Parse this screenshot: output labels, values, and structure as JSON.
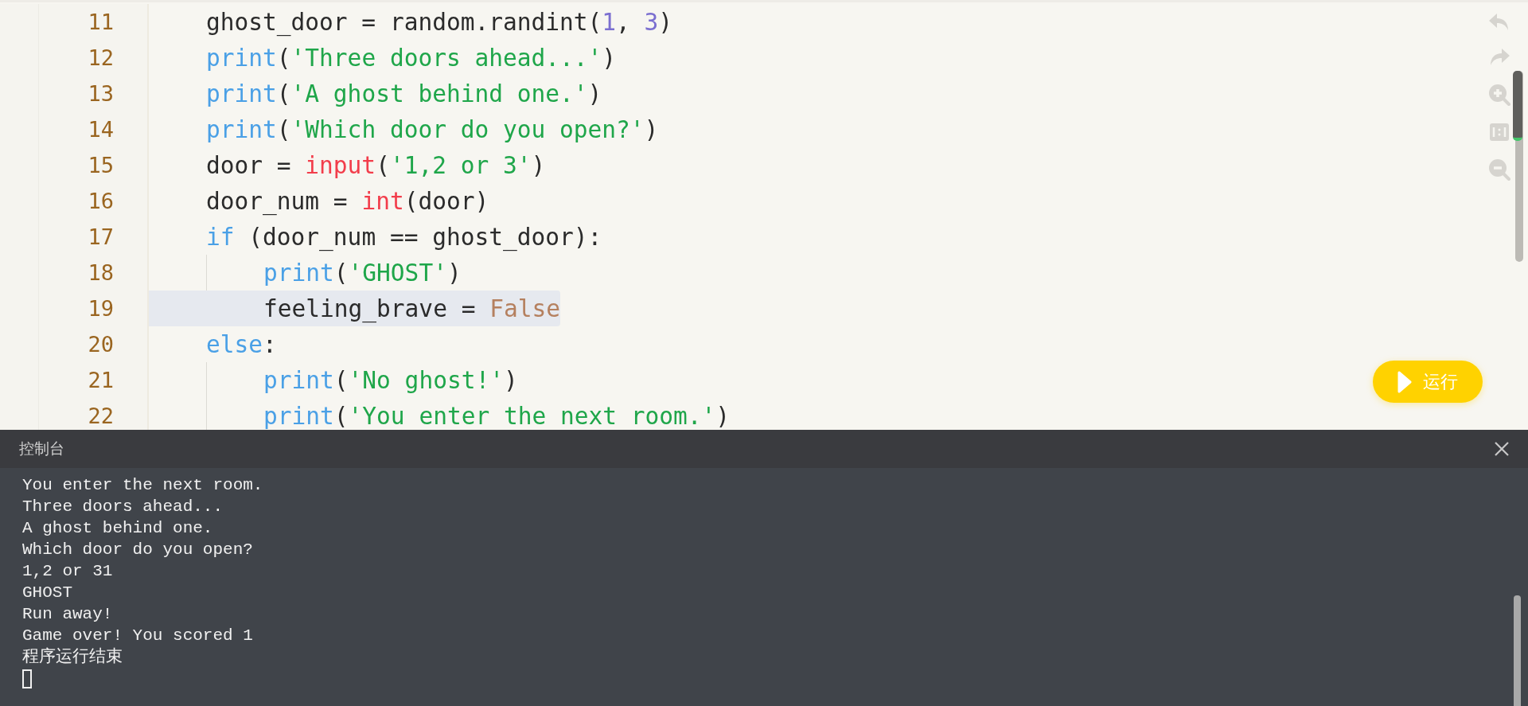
{
  "editor": {
    "lines": [
      {
        "number": "11",
        "selected": false,
        "tokens": [
          {
            "kind": "plain",
            "text": "ghost_door = random.randint("
          },
          {
            "kind": "number",
            "text": "1"
          },
          {
            "kind": "plain",
            "text": ", "
          },
          {
            "kind": "number",
            "text": "3"
          },
          {
            "kind": "plain",
            "text": ")"
          }
        ]
      },
      {
        "number": "12",
        "selected": false,
        "tokens": [
          {
            "kind": "builtin",
            "text": "print"
          },
          {
            "kind": "plain",
            "text": "("
          },
          {
            "kind": "string",
            "text": "'Three doors ahead...'"
          },
          {
            "kind": "plain",
            "text": ")"
          }
        ]
      },
      {
        "number": "13",
        "selected": false,
        "tokens": [
          {
            "kind": "builtin",
            "text": "print"
          },
          {
            "kind": "plain",
            "text": "("
          },
          {
            "kind": "string",
            "text": "'A ghost behind one.'"
          },
          {
            "kind": "plain",
            "text": ")"
          }
        ]
      },
      {
        "number": "14",
        "selected": false,
        "tokens": [
          {
            "kind": "builtin",
            "text": "print"
          },
          {
            "kind": "plain",
            "text": "("
          },
          {
            "kind": "string",
            "text": "'Which door do you open?'"
          },
          {
            "kind": "plain",
            "text": ")"
          }
        ]
      },
      {
        "number": "15",
        "selected": false,
        "tokens": [
          {
            "kind": "plain",
            "text": "door = "
          },
          {
            "kind": "call",
            "text": "input"
          },
          {
            "kind": "plain",
            "text": "("
          },
          {
            "kind": "string",
            "text": "'1,2 or 3'"
          },
          {
            "kind": "plain",
            "text": ")"
          }
        ]
      },
      {
        "number": "16",
        "selected": false,
        "tokens": [
          {
            "kind": "plain",
            "text": "door_num = "
          },
          {
            "kind": "call",
            "text": "int"
          },
          {
            "kind": "plain",
            "text": "(door)"
          }
        ]
      },
      {
        "number": "17",
        "selected": false,
        "tokens": [
          {
            "kind": "keyword",
            "text": "if"
          },
          {
            "kind": "plain",
            "text": " (door_num == ghost_door):"
          }
        ],
        "children": [
          {
            "number": "18",
            "selected": false,
            "tokens": [
              {
                "kind": "builtin",
                "text": "print"
              },
              {
                "kind": "plain",
                "text": "("
              },
              {
                "kind": "string",
                "text": "'GHOST'"
              },
              {
                "kind": "plain",
                "text": ")"
              }
            ]
          },
          {
            "number": "19",
            "selected": true,
            "tokens": [
              {
                "kind": "plain",
                "text": "feeling_brave = "
              },
              {
                "kind": "constant",
                "text": "False"
              }
            ]
          }
        ]
      },
      {
        "number": "20",
        "selected": false,
        "tokens": [
          {
            "kind": "keyword",
            "text": "else"
          },
          {
            "kind": "plain",
            "text": ":"
          }
        ],
        "children": [
          {
            "number": "21",
            "selected": false,
            "tokens": [
              {
                "kind": "builtin",
                "text": "print"
              },
              {
                "kind": "plain",
                "text": "("
              },
              {
                "kind": "string",
                "text": "'No ghost!'"
              },
              {
                "kind": "plain",
                "text": ")"
              }
            ]
          },
          {
            "number": "22",
            "selected": false,
            "tokens": [
              {
                "kind": "builtin",
                "text": "print"
              },
              {
                "kind": "plain",
                "text": "("
              },
              {
                "kind": "string",
                "text": "'You enter the next room.'"
              },
              {
                "kind": "plain",
                "text": ")"
              }
            ]
          }
        ]
      }
    ],
    "run_button": "运行"
  },
  "console": {
    "title": "控制台",
    "output": [
      "You enter the next room.",
      "Three doors ahead...",
      "A ghost behind one.",
      "Which door do you open?",
      "1,2 or 31",
      "GHOST",
      "Run away!",
      "Game over! You scored 1",
      "程序运行结束"
    ]
  }
}
